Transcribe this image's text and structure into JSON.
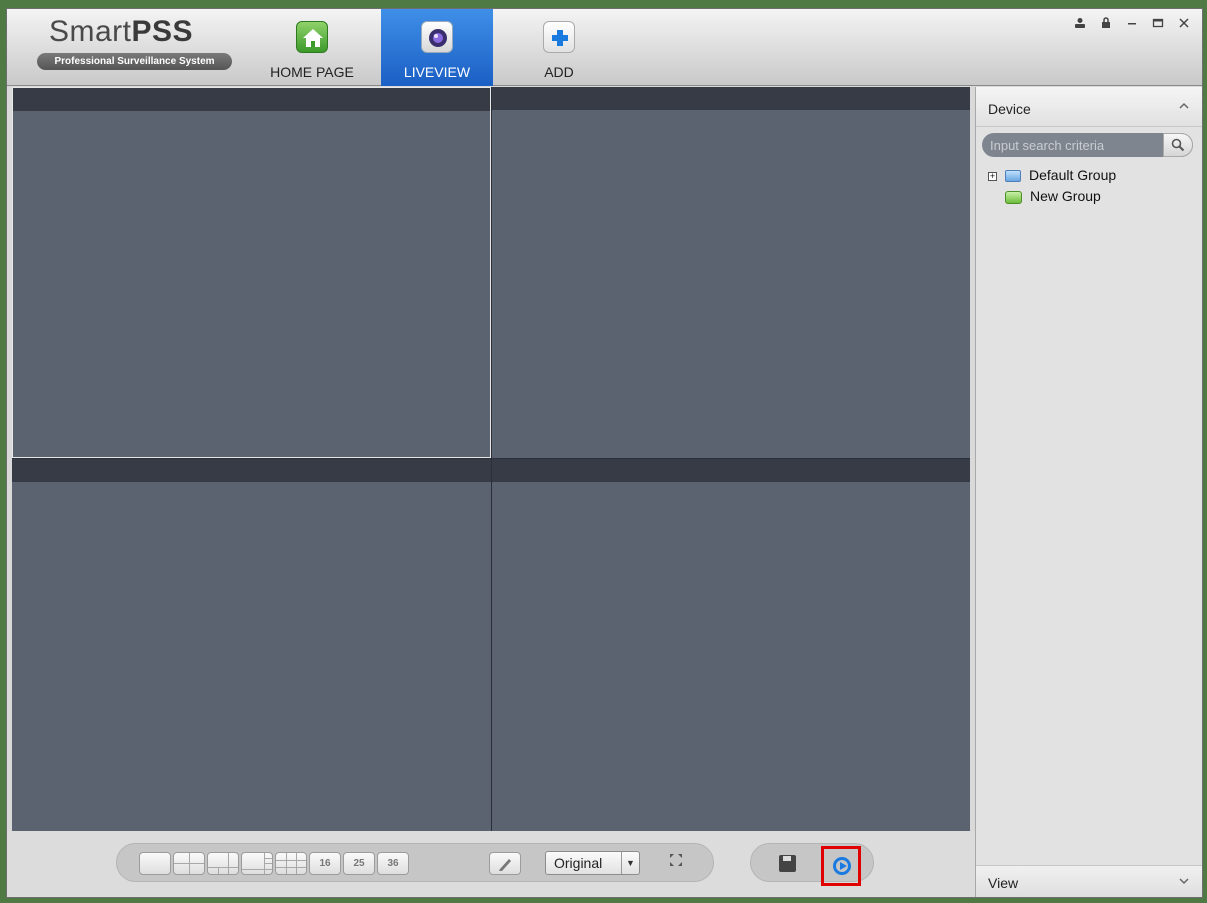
{
  "app": {
    "logo_main": "Smart",
    "logo_bold": "PSS",
    "logo_tagline": "Professional Surveillance System"
  },
  "nav": {
    "home_label": "HOME PAGE",
    "liveview_label": "LIVEVIEW",
    "add_label": "ADD",
    "active": "LIVEVIEW"
  },
  "window_controls": {
    "user_icon": "user-icon",
    "lock_icon": "lock-icon",
    "minimize_icon": "minimize-icon",
    "maximize_icon": "maximize-icon",
    "close_icon": "close-icon"
  },
  "toolbar": {
    "layouts": [
      "1",
      "4",
      "6",
      "8",
      "9",
      "16",
      "25",
      "36"
    ],
    "layout_16_label": "16",
    "layout_25_label": "25",
    "layout_36_label": "36",
    "ratio_value": "Original",
    "ratio_arrow": "▼"
  },
  "device_panel": {
    "title": "Device",
    "search_placeholder": "Input search criteria",
    "tree": {
      "default_group": "Default Group",
      "new_group": "New Group"
    }
  },
  "view_panel": {
    "title": "View"
  },
  "colors": {
    "accent_active_tab": "#1b5fc4",
    "highlight_box": "#e00000",
    "video_pane": "#5b6270"
  }
}
